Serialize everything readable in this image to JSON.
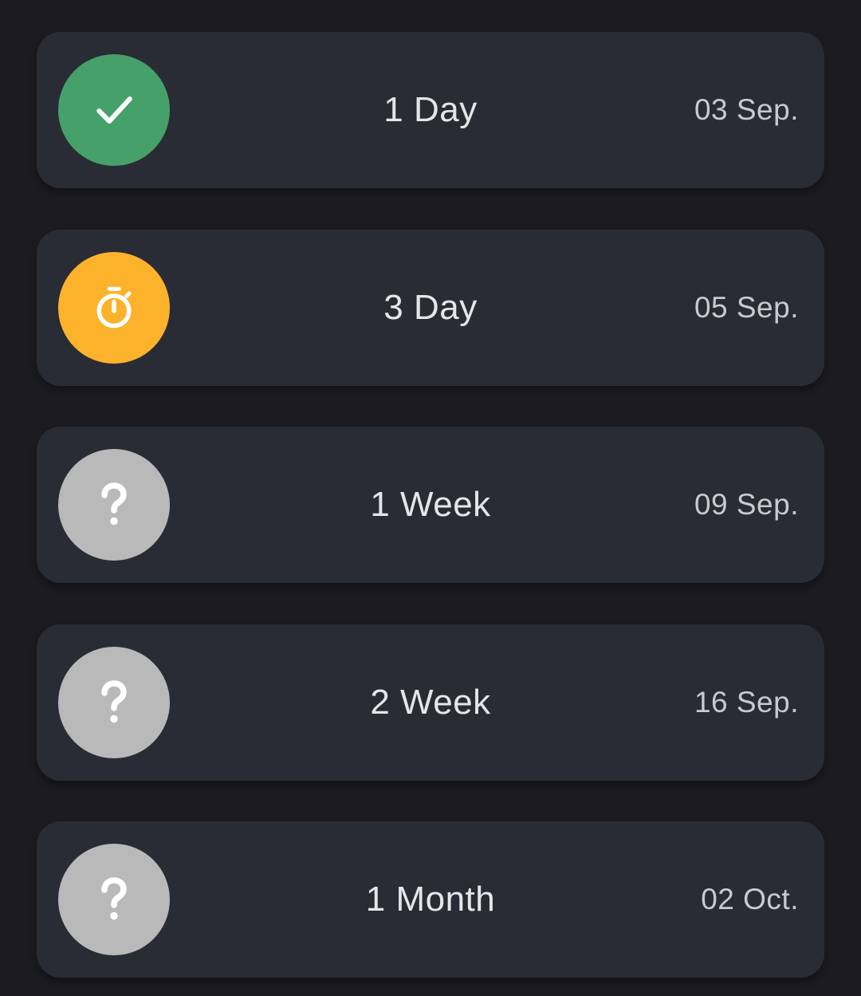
{
  "colors": {
    "background": "#1c1b21",
    "card": "#2a2c35",
    "done": "#46a06a",
    "active": "#fdb22b",
    "pending": "#b9b9b9"
  },
  "milestones": [
    {
      "label": "1 Day",
      "date": "03 Sep.",
      "status": "done",
      "icon": "checkmark-icon"
    },
    {
      "label": "3 Day",
      "date": "05 Sep.",
      "status": "active",
      "icon": "stopwatch-icon"
    },
    {
      "label": "1 Week",
      "date": "09 Sep.",
      "status": "pending",
      "icon": "question-mark-icon"
    },
    {
      "label": "2 Week",
      "date": "16 Sep.",
      "status": "pending",
      "icon": "question-mark-icon"
    },
    {
      "label": "1 Month",
      "date": "02 Oct.",
      "status": "pending",
      "icon": "question-mark-icon"
    }
  ]
}
